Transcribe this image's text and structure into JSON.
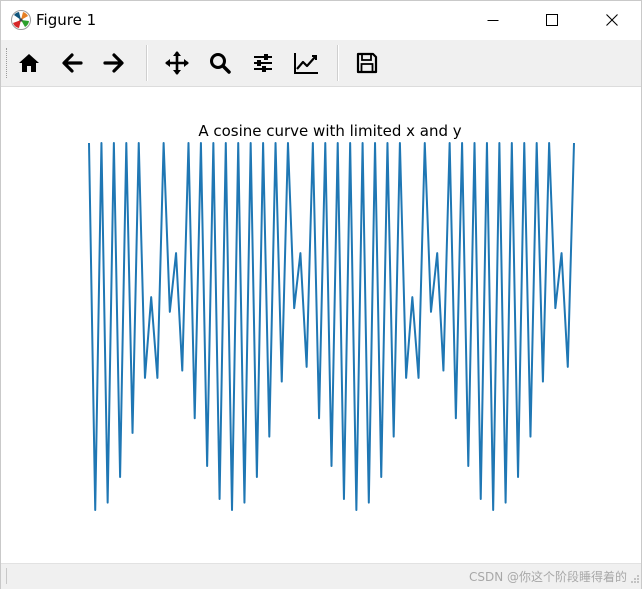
{
  "window": {
    "title": "Figure 1",
    "icon": "matplotlib-icon",
    "controls": [
      "minimize-icon",
      "maximize-icon",
      "close-icon"
    ]
  },
  "toolbar": {
    "tools": [
      {
        "name": "home",
        "icon": "home-icon"
      },
      {
        "name": "back",
        "icon": "arrow-left-icon"
      },
      {
        "name": "forward",
        "icon": "arrow-right-icon"
      },
      {
        "name": "pan",
        "icon": "move-icon"
      },
      {
        "name": "zoom",
        "icon": "magnifier-icon"
      },
      {
        "name": "configure-subplots",
        "icon": "sliders-icon"
      },
      {
        "name": "edit-axes",
        "icon": "line-chart-icon"
      },
      {
        "name": "save",
        "icon": "floppy-disk-icon"
      }
    ]
  },
  "figure": {
    "title": "A cosine curve with limited x and y",
    "line_color": "#1f77b4"
  },
  "chart_data": {
    "type": "line",
    "title": "A cosine curve with limited x and y",
    "xlabel": "",
    "ylabel": "",
    "axes_visible": false,
    "grid": false,
    "ylim": [
      0,
      1
    ],
    "x": [
      0,
      0.5,
      1,
      1.5,
      2,
      2.5,
      3,
      3.5,
      4,
      4.5,
      5,
      5.5,
      6,
      6.5,
      7,
      7.5,
      8,
      8.5,
      9,
      9.5,
      10,
      10.5,
      11,
      11.5,
      12,
      12.5,
      13,
      13.5,
      14,
      14.5,
      15,
      15.5,
      16,
      16.5,
      17,
      17.5,
      18,
      18.5,
      19,
      19.5,
      20,
      20.5,
      21,
      21.5,
      22,
      22.5,
      23,
      23.5,
      24,
      24.5,
      25,
      25.5,
      26,
      26.5,
      27,
      27.5,
      28,
      28.5,
      29,
      29.5,
      30,
      30.5,
      31,
      31.5,
      32,
      32.5,
      33,
      33.5,
      34,
      34.5,
      35,
      35.5,
      36,
      36.5,
      37,
      37.5,
      38,
      38.5,
      39
    ],
    "y": [
      1.0,
      0.0,
      1.0,
      0.02,
      1.0,
      0.09,
      1.0,
      0.21,
      1.0,
      0.36,
      0.58,
      0.36,
      1.0,
      0.54,
      0.7,
      0.38,
      1.0,
      0.25,
      1.0,
      0.12,
      1.0,
      0.03,
      1.0,
      0.0,
      1.0,
      0.02,
      1.0,
      0.09,
      1.0,
      0.2,
      1.0,
      0.35,
      1.0,
      0.55,
      0.7,
      0.39,
      1.0,
      0.25,
      1.0,
      0.12,
      1.0,
      0.03,
      1.0,
      0.0,
      1.0,
      0.02,
      1.0,
      0.09,
      1.0,
      0.2,
      1.0,
      0.36,
      0.58,
      0.36,
      1.0,
      0.54,
      0.7,
      0.38,
      1.0,
      0.25,
      1.0,
      0.12,
      1.0,
      0.03,
      1.0,
      0.0,
      1.0,
      0.02,
      1.0,
      0.09,
      1.0,
      0.2,
      1.0,
      0.35,
      1.0,
      0.55,
      0.7,
      0.39,
      1.0
    ],
    "series": [
      {
        "color": "#1f77b4"
      }
    ]
  },
  "statusbar": {
    "watermark": "CSDN @你这个阶段睡得着的"
  }
}
